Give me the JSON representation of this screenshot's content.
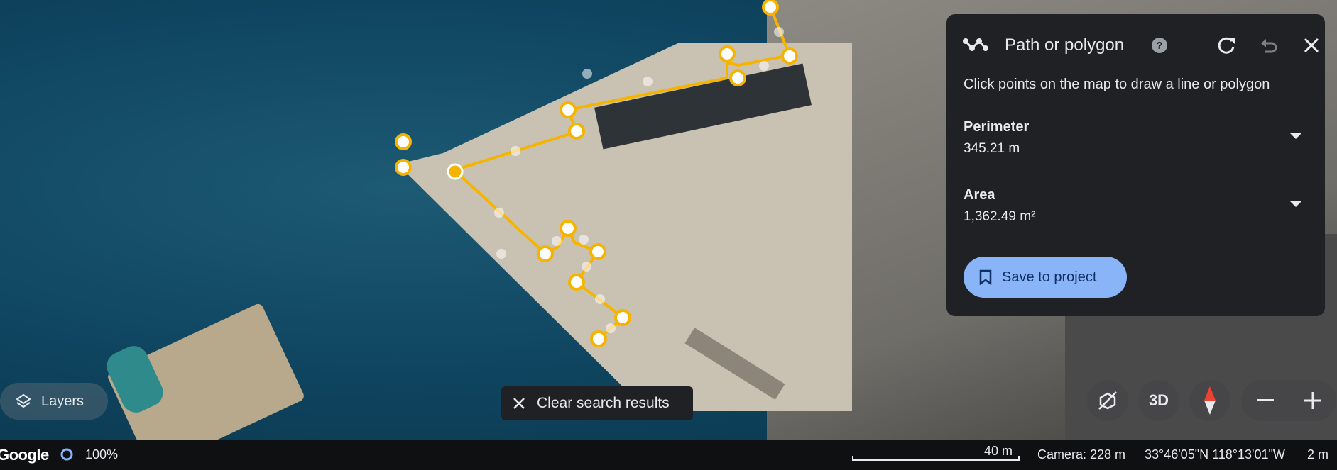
{
  "panel": {
    "title": "Path or polygon",
    "instruction": "Click points on the map to draw a line or polygon",
    "perimeter_label": "Perimeter",
    "perimeter_value": "345.21 m",
    "area_label": "Area",
    "area_value": "1,362.49 m²",
    "save_label": "Save to project"
  },
  "layers_label": "Layers",
  "clear_search_label": "Clear search results",
  "view_3d_label": "3D",
  "status": {
    "logo": "Google",
    "load_percent": "100%",
    "scale": "40 m",
    "camera": "Camera: 228 m",
    "coordinates": "33°46'05\"N 118°13'01\"W",
    "elevation": "2 m"
  },
  "colors": {
    "polygon": "#f5b400",
    "panel_bg": "#202124",
    "save_button": "#8ab4f8"
  }
}
